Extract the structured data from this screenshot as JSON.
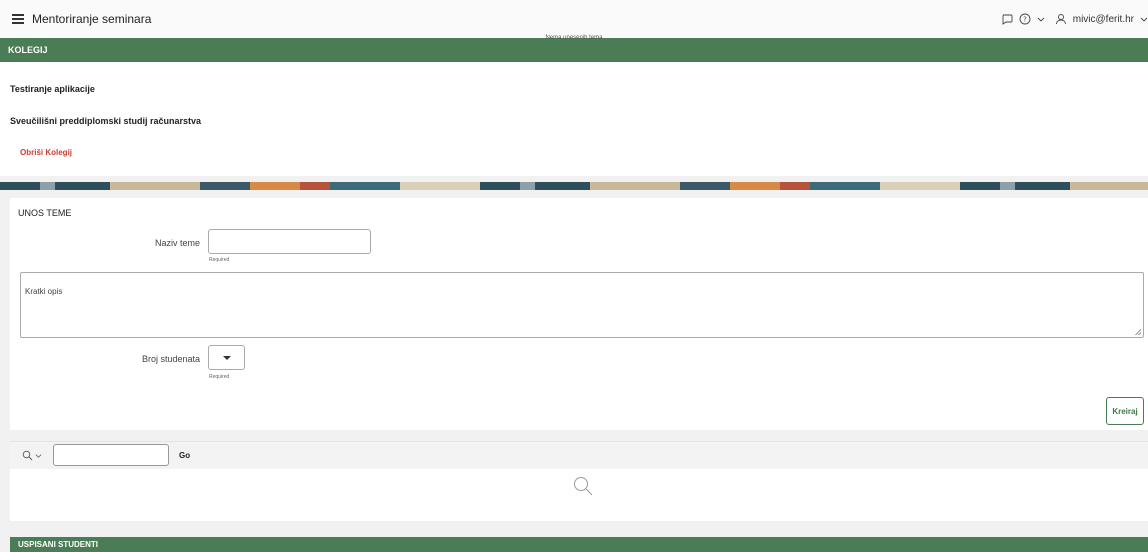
{
  "header": {
    "title": "Mentoriranje seminara",
    "user": "mivic@ferit.hr"
  },
  "kolegij": {
    "band_title": "KOLEGIJ",
    "course_name": "Testiranje aplikacije",
    "study_program": "Sveučilišni preddiplomski studij računarstva",
    "delete_label": "Obriši Kolegij"
  },
  "unos_teme": {
    "title": "UNOS TEME",
    "naziv_label": "Naziv teme",
    "naziv_value": "",
    "required": "Required",
    "opis_label": "Kratki opis",
    "opis_value": "",
    "broj_label": "Broj studenata",
    "broj_value": "",
    "create_label": "Kreiraj"
  },
  "search": {
    "value": "",
    "go_label": "Go",
    "empty_message": "Nema unesenih tema"
  },
  "uspisani": {
    "band_title": "USPISANI STUDENTI"
  },
  "colors": {
    "accent_green": "#4a7d56",
    "danger_red": "#d13b2e"
  },
  "icons": [
    "hamburger-icon",
    "chat-icon",
    "help-icon",
    "chevron-down-icon",
    "user-icon",
    "search-icon"
  ]
}
